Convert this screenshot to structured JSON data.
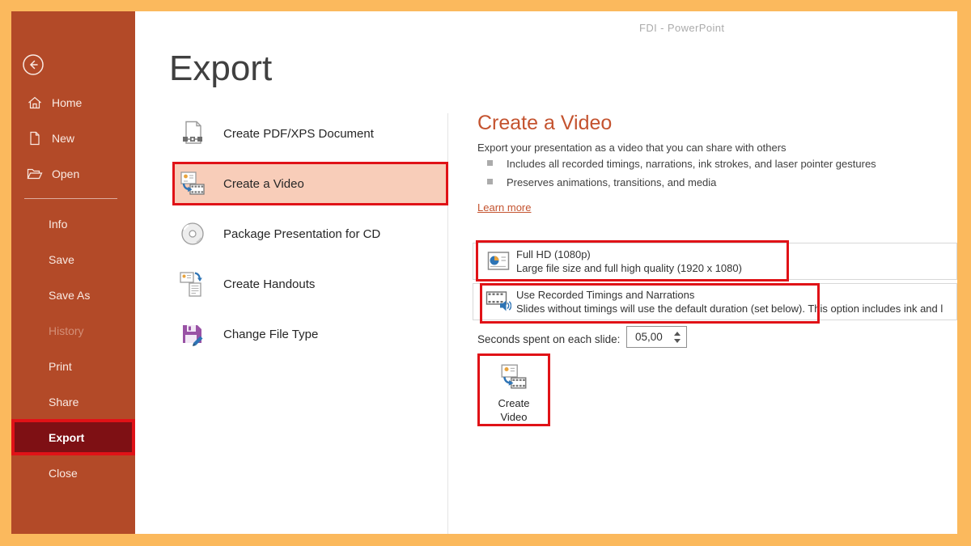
{
  "window": {
    "title": "FDI - PowerPoint"
  },
  "colors": {
    "frame_border": "#FBB95D",
    "sidebar": "#B34A28",
    "sidebar_active_bg": "#7E1014",
    "annotation_red": "#E01217",
    "highlight_peach": "#F8CDB9",
    "heading_accent": "#C4532F"
  },
  "sidebar": {
    "top_items": [
      {
        "label": "Home",
        "icon": "home-icon"
      },
      {
        "label": "New",
        "icon": "new-document-icon"
      },
      {
        "label": "Open",
        "icon": "open-folder-icon"
      }
    ],
    "menu_items": [
      {
        "label": "Info"
      },
      {
        "label": "Save"
      },
      {
        "label": "Save As"
      },
      {
        "label": "History",
        "disabled": true
      },
      {
        "label": "Print"
      },
      {
        "label": "Share"
      },
      {
        "label": "Export",
        "active": true
      },
      {
        "label": "Close"
      }
    ]
  },
  "export_page": {
    "title": "Export",
    "options": [
      {
        "label": "Create PDF/XPS Document",
        "icon": "pdf-xps-icon"
      },
      {
        "label": "Create a Video",
        "icon": "create-video-icon",
        "selected": true
      },
      {
        "label": "Package Presentation for CD",
        "icon": "cd-icon"
      },
      {
        "label": "Create Handouts",
        "icon": "handouts-icon"
      },
      {
        "label": "Change File Type",
        "icon": "change-file-type-icon"
      }
    ]
  },
  "detail": {
    "heading": "Create a Video",
    "description": "Export your presentation as a video that you can share with others",
    "bullets": [
      "Includes all recorded timings, narrations, ink strokes, and laser pointer gestures",
      "Preserves animations, transitions, and media"
    ],
    "learn_more": "Learn more",
    "quality_dropdown": {
      "title": "Full HD (1080p)",
      "subtitle": "Large file size and full high quality (1920 x 1080)"
    },
    "timings_dropdown": {
      "title": "Use Recorded Timings and Narrations",
      "subtitle": "Slides without timings will use the default duration (set below). This option includes ink and l"
    },
    "seconds_label": "Seconds spent on each slide:",
    "seconds_value": "05,00",
    "create_button_label": "Create Video"
  }
}
